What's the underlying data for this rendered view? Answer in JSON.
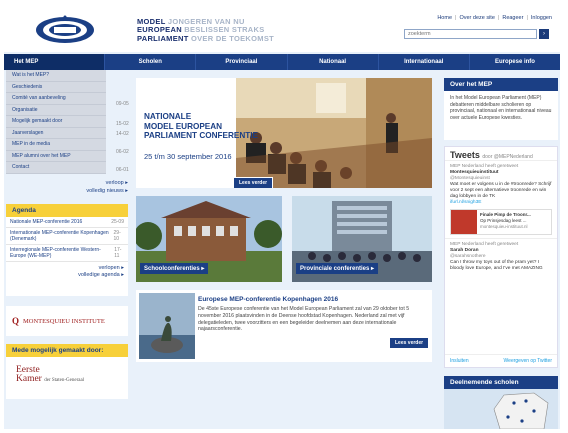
{
  "header": {
    "logo_lines": [
      {
        "bold": "MODEL",
        "light": "JONGEREN VAN NU"
      },
      {
        "bold": "EUROPEAN",
        "light": "BESLISSEN STRAKS"
      },
      {
        "bold": "PARLIAMENT",
        "light": "OVER DE TOEKOMST"
      }
    ],
    "toplinks": [
      "Home",
      "Over deze site",
      "Reageer",
      "Inloggen"
    ],
    "search_placeholder": "zoekterm",
    "search_button": "›"
  },
  "nav": [
    "Het MEP",
    "Scholen",
    "Provinciaal",
    "Nationaal",
    "Internationaal",
    "Europese info"
  ],
  "dropdown": [
    "Wat is het MEP?",
    "Geschiedenis",
    "Comité van aanbeveling",
    "Organisatie",
    "Mogelijk gemaakt door",
    "Jaarverslagen",
    "MEP in de media",
    "MEP alumni over het MEP",
    "Contact"
  ],
  "news_dates": [
    "09-05",
    "15-02",
    "14-02",
    "06-02",
    "06-01"
  ],
  "news_links": {
    "more": "verloop ▸",
    "all": "volledig nieuws ▸"
  },
  "agenda": {
    "title": "Agenda",
    "rows": [
      {
        "name": "Nationale MEP-conferentie 2016",
        "date": "25-09"
      },
      {
        "name": "Internationale MEP-conferentie Kopenhagen (Denemark)",
        "date": "29-10"
      },
      {
        "name": "Interregionale MEP-conferentie Western-Europe (WE-MEP)",
        "date": "17-11"
      }
    ],
    "more": "verlopen ▸",
    "all": "volledige agenda ▸"
  },
  "montesquieu": "MONTESQUIEU INSTITUTE",
  "mogelijk": {
    "title": "Mede mogelijk gemaakt door:",
    "logo_line1": "Eerste",
    "logo_line2": "Kamer",
    "logo_sub": "der Staten-Generaal"
  },
  "hero": {
    "line1": "NATIONALE",
    "line2": "MODEL EUROPEAN",
    "line3": "PARLIAMENT CONFERENTIE",
    "date": "25 t/m 30 september 2016",
    "button": "Lees verder"
  },
  "cards": {
    "schools": "Schoolconferenties ▸",
    "provincial": "Provinciale conferenties ▸"
  },
  "article": {
    "title": "Europese MEP-conferentie Kopenhagen 2016",
    "body": "De 45ste Europese conferentie van het Model European Parliament zal van 29 oktober tot 5 november 2016 plaatsvinden in de Deense hoofdstad Kopenhagen. Nederland zal met vijf delegatieleden, twee voorzitters en een begeleider deelnemen aan deze internationale najaarsconferentie.",
    "button": "Lees verder"
  },
  "over": {
    "title": "Over het MEP",
    "text": "In het Model European Parliament (MEP) debatteren middelbare scholieren op provinciaal, nationaal en internationaal niveau over actuele Europese kwesties."
  },
  "tweets": {
    "title": "Tweets",
    "by": "door @MEPNederland",
    "items": [
      {
        "rt": "MEP Nederland heeft geretweet",
        "name": "Montesquieuinstituut",
        "handle": "@Montesquieuinst",
        "text": "Wat moet er volgens u in de #troonrede? Schrijf voor 2 sept een alternatieve troonrede en win dag lobbyen in de TK",
        "link": "ifurl.nl/snigh3E",
        "card_title": "Finale Pimp de Troonr...",
        "card_sub": "Op Prinsjesdag leest ...",
        "card_url": "montesquieu-instituut.nl"
      },
      {
        "rt": "MEP Nederland heeft geretweet",
        "name": "Sarah Doran",
        "handle": "@sarahsnothere",
        "text": "Can I throw my toys out of the pram yet? I bloody love Europe, and I've met AMAZING"
      }
    ],
    "foot_left": "Insluiten",
    "foot_right": "Weergeven op Twitter"
  },
  "deelnemende": {
    "title": "Deelnemende scholen"
  }
}
